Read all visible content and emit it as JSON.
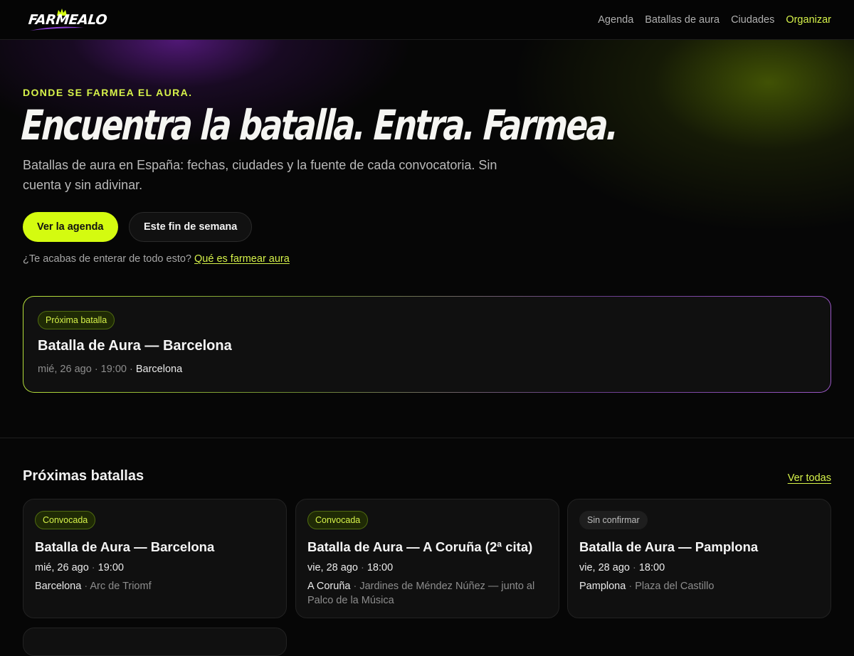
{
  "nav": {
    "logo_text": "FARMEALO",
    "links": [
      "Agenda",
      "Batallas de aura",
      "Ciudades",
      "Organizar"
    ]
  },
  "hero": {
    "eyebrow": "DONDE SE FARMEA EL AURA.",
    "headline": "Encuentra la batalla. Entra. Farmea.",
    "subtitle": "Batallas de aura en España: fechas, ciudades y la fuente de cada convocatoria. Sin cuenta y sin adivinar.",
    "primary_cta": "Ver la agenda",
    "secondary_cta": "Este fin de semana",
    "hint_text": "¿Te acabas de enterar de todo esto?",
    "hint_link": "Qué es farmear aura"
  },
  "featured": {
    "badge": "Próxima batalla",
    "title": "Batalla de Aura — Barcelona",
    "date": "mié, 26 ago",
    "time": "19:00",
    "city": "Barcelona"
  },
  "upcoming": {
    "title": "Próximas batallas",
    "see_all": "Ver todas",
    "cards": [
      {
        "status": "Convocada",
        "title": "Batalla de Aura — Barcelona",
        "date": "mié, 26 ago",
        "time": "19:00",
        "city": "Barcelona",
        "venue": "Arc de Triomf"
      },
      {
        "status": "Convocada",
        "title": "Batalla de Aura — A Coruña (2ª cita)",
        "date": "vie, 28 ago",
        "time": "18:00",
        "city": "A Coruña",
        "venue": "Jardines de Méndez Núñez — junto al Palco de la Música"
      },
      {
        "status": "Sin confirmar",
        "title": "Batalla de Aura — Pamplona",
        "date": "vie, 28 ago",
        "time": "18:00",
        "city": "Pamplona",
        "venue": "Plaza del Castillo"
      }
    ]
  },
  "colors": {
    "accent": "#d4fb10",
    "accent_text": "#d7f34a",
    "background": "#060606",
    "card": "#101010",
    "hero_glow_purple": "#691e9b",
    "hero_glow_olive": "#4b5f05"
  }
}
